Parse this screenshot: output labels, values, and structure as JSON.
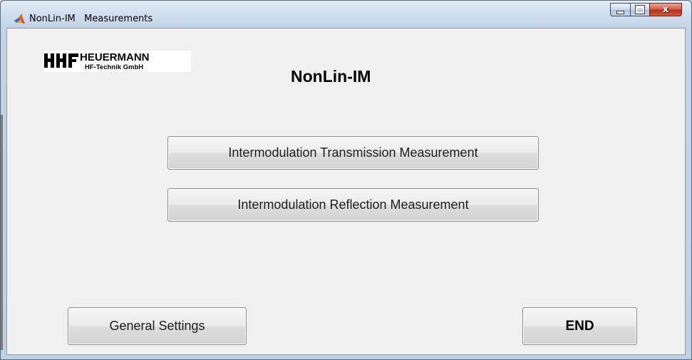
{
  "window": {
    "title": "NonLin-IM   Measurements",
    "close_glyph": "x"
  },
  "logo": {
    "brand": "HEUERMANN",
    "company": "HF-Technik GmbH",
    "mark": "HHF"
  },
  "main": {
    "heading": "NonLin-IM",
    "transmission_button": "Intermodulation Transmission Measurement",
    "reflection_button": "Intermodulation Reflection Measurement",
    "settings_button": "General Settings",
    "end_button": "END"
  },
  "icons": {
    "app": "matlab-icon",
    "minimize": "minimize-icon",
    "maximize": "maximize-icon",
    "close": "close-icon"
  },
  "colors": {
    "titlebar": "#d0deee",
    "client_bg": "#f0f0f0",
    "close_button": "#c7402a"
  }
}
